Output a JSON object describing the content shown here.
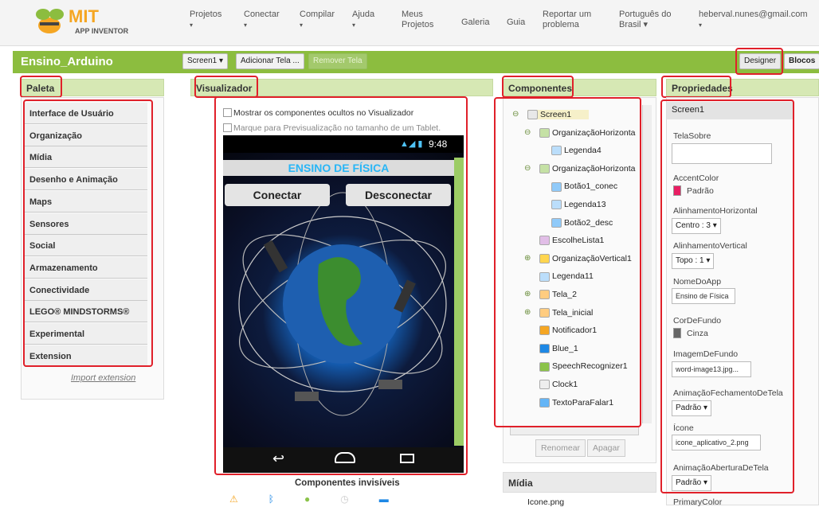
{
  "app": {
    "brand": "MIT",
    "brand_sub": "APP INVENTOR"
  },
  "menu": [
    {
      "label": "Projetos",
      "caret": "▾"
    },
    {
      "label": "Conectar",
      "caret": "▾"
    },
    {
      "label": "Compilar",
      "caret": "▾"
    },
    {
      "label": "Ajuda",
      "caret": "▾"
    },
    {
      "label": "Meus Projetos",
      "caret": ""
    },
    {
      "label": "Galeria",
      "caret": ""
    },
    {
      "label": "Guia",
      "caret": ""
    },
    {
      "label": "Reportar um problema",
      "caret": ""
    },
    {
      "label": "Português do Brasil ▾",
      "caret": ""
    },
    {
      "label": "heberval.nunes@gmail.com",
      "caret": "▾"
    }
  ],
  "project": {
    "name": "Ensino_Arduino",
    "screen_select": "Screen1 ▾",
    "add_screen": "Adicionar Tela ...",
    "remove_screen": "Remover Tela",
    "designer": "Designer",
    "blocks": "Blocos"
  },
  "palette": {
    "title": "Paleta",
    "items": [
      "Interface de Usuário",
      "Organização",
      "Mídia",
      "Desenho e Animação",
      "Maps",
      "Sensores",
      "Social",
      "Armazenamento",
      "Conectividade",
      "LEGO® MINDSTORMS®",
      "Experimental",
      "Extension"
    ],
    "import": "Import extension"
  },
  "viewer": {
    "title": "Visualizador",
    "show_hidden": "Mostrar os componentes ocultos no Visualizador",
    "tablet_preview": "Marque para Previsualização no tamanho de um Tablet.",
    "status_time": "9:48",
    "app_title": "ENSINO DE FÍSICA",
    "btn_connect": "Conectar",
    "btn_disconnect": "Desconectar",
    "invisible_title": "Componentes invisíveis"
  },
  "components": {
    "title": "Componentes",
    "items": [
      {
        "label": "Screen1",
        "toggle": "⊖"
      },
      {
        "label": "OrganizaçãoHorizonta",
        "toggle": "⊖"
      },
      {
        "label": "Legenda4",
        "toggle": ""
      },
      {
        "label": "OrganizaçãoHorizonta",
        "toggle": "⊖"
      },
      {
        "label": "Botão1_conec",
        "toggle": ""
      },
      {
        "label": "Legenda13",
        "toggle": ""
      },
      {
        "label": "Botão2_desc",
        "toggle": ""
      },
      {
        "label": "EscolheLista1",
        "toggle": ""
      },
      {
        "label": "OrganizaçãoVertical1",
        "toggle": "⊕"
      },
      {
        "label": "Legenda11",
        "toggle": ""
      },
      {
        "label": "Tela_2",
        "toggle": "⊕"
      },
      {
        "label": "Tela_inicial",
        "toggle": "⊕"
      },
      {
        "label": "Notificador1",
        "toggle": ""
      },
      {
        "label": "Blue_1",
        "toggle": ""
      },
      {
        "label": "SpeechRecognizer1",
        "toggle": ""
      },
      {
        "label": "Clock1",
        "toggle": ""
      },
      {
        "label": "TextoParaFalar1",
        "toggle": ""
      }
    ],
    "rename": "Renomear",
    "delete": "Apagar",
    "media_title": "Mídia",
    "media_item": "Icone.png"
  },
  "properties": {
    "title": "Propriedades",
    "screen": "Screen1",
    "tela_sobre": "TelaSobre",
    "accent_label": "AccentColor",
    "accent_value": "Padrão",
    "align_h_label": "AlinhamentoHorizontal",
    "align_h_value": "Centro : 3 ▾",
    "align_v_label": "AlinhamentoVertical",
    "align_v_value": "Topo : 1 ▾",
    "app_name_label": "NomeDoApp",
    "app_name_value": "Ensino de Física",
    "bg_color_label": "CorDeFundo",
    "bg_color_value": "Cinza",
    "bg_image_label": "ImagemDeFundo",
    "bg_image_value": "word-image13.jpg...",
    "close_anim_label": "AnimaçãoFechamentoDeTela",
    "close_anim_value": "Padrão ▾",
    "icon_label": "Ícone",
    "icon_value": "icone_aplicativo_2.png",
    "open_anim_label": "AnimaçãoAberturaDeTela",
    "open_anim_value": "Padrão ▾",
    "primary_label": "PrimaryColor"
  },
  "colors": {
    "green": "#8cbd3f",
    "accent": "#e91e63",
    "gray": "#666666"
  }
}
